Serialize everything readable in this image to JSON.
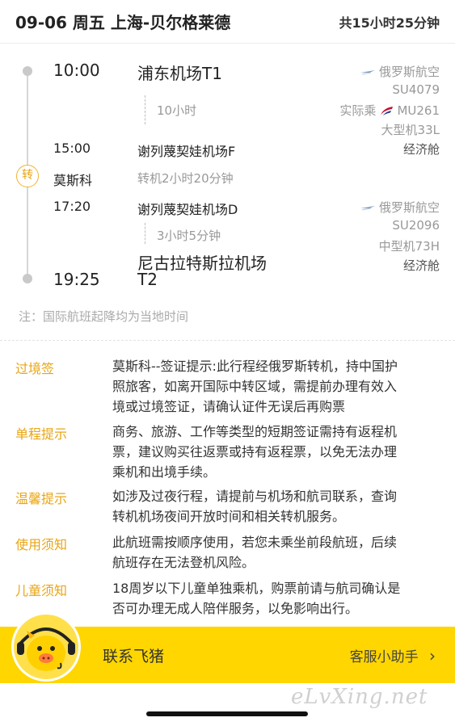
{
  "header": {
    "title": "09-06 周五 上海-贝尔格莱德",
    "total_duration": "共15小时25分钟"
  },
  "segment1": {
    "depart_time": "10:00",
    "depart_airport": "浦东机场T1",
    "flight_duration": "10小时",
    "arrive_time": "15:00",
    "arrive_airport": "谢列蔑契娃机场F",
    "airline": "俄罗斯航空",
    "flight_no": "SU4079",
    "operated_label": "实际乘",
    "operated_flight": "MU261",
    "aircraft": "大型机33L",
    "cabin": "经济舱"
  },
  "transfer": {
    "badge": "转",
    "city": "莫斯科",
    "info": "转机2小时20分钟"
  },
  "segment2": {
    "depart_time": "17:20",
    "depart_airport": "谢列蔑契娃机场D",
    "flight_duration": "3小时5分钟",
    "arrive_time": "19:25",
    "arrive_airport_line1": "尼古拉特斯拉机场",
    "arrive_airport_line2": "T2",
    "airline": "俄罗斯航空",
    "flight_no": "SU2096",
    "aircraft": "中型机73H",
    "cabin": "经济舱"
  },
  "note": "注：国际航班起降均为当地时间",
  "notices": [
    {
      "label": "过境签",
      "lines": [
        "莫斯科--签证提示:此行程经俄罗斯转机，持中国护",
        "照旅客，如离开国际中转区域，需提前办理有效入",
        "境或过境签证，请确认证件无误后再购票"
      ]
    },
    {
      "label": "单程提示",
      "lines": [
        "商务、旅游、工作等类型的短期签证需持有返程机",
        "票，建议购买往返票或持有返程票，以免无法办理",
        "乘机和出境手续。"
      ]
    },
    {
      "label": "温馨提示",
      "lines": [
        "如涉及过夜行程，请提前与机场和航司联系，查询",
        "转机机场夜间开放时间和相关转机服务。"
      ]
    },
    {
      "label": "使用须知",
      "lines": [
        "此航班需按顺序使用，若您未乘坐前段航班，后续",
        "航班存在无法登机风险。"
      ]
    },
    {
      "label": "儿童须知",
      "lines": [
        "18周岁以下儿童单独乘机，购票前请与航司确认是",
        "否可办理无成人陪伴服务，以免影响出行。"
      ]
    }
  ],
  "footer": {
    "contact_label": "联系飞猪",
    "assistant_label": "客服小助手",
    "chevron": "›"
  },
  "watermark": "eLvXing.net",
  "colors": {
    "accent": "#e9a514",
    "footer_bg": "#ffd600",
    "aeroflot_blue": "#7a9cc6",
    "china_eastern_red": "#c8102e"
  }
}
